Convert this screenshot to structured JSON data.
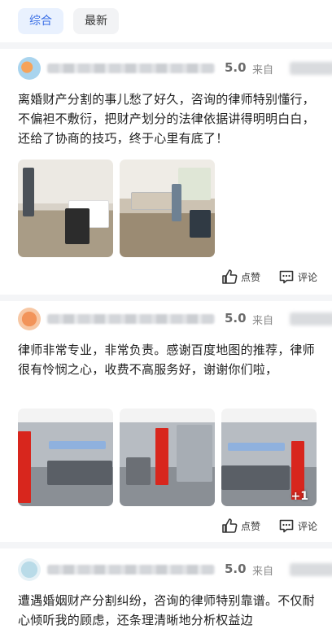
{
  "tabs": [
    {
      "label": "综合",
      "active": true
    },
    {
      "label": "最新",
      "active": false
    }
  ],
  "colors": {
    "accent": "#3a6fe6",
    "tab_active_bg": "#e9f1fe",
    "divider": "#f4f5f7"
  },
  "reviews": [
    {
      "score": "5.0",
      "source_prefix": "来自",
      "text": "离婚财产分割的事儿愁了好久，咨询的律师特别懂行，不偏袒不敷衍，把财产划分的法律依据讲得明明白白，还给了协商的技巧，终于心里有底了！",
      "photos": [
        "office-photo-1",
        "office-photo-2"
      ],
      "like_label": "点赞",
      "comment_label": "评论"
    },
    {
      "score": "5.0",
      "source_prefix": "来自",
      "text": "律师非常专业，非常负责。感谢百度地图的推荐，律师很有怜悯之心，收费不高服务好，谢谢你们啦，",
      "photos": [
        "lobby-photo-1",
        "lobby-photo-2",
        "lobby-photo-3"
      ],
      "more_count": "+1",
      "like_label": "点赞",
      "comment_label": "评论"
    },
    {
      "score": "5.0",
      "source_prefix": "来自",
      "text": "遭遇婚姻财产分割纠纷，咨询的律师特别靠谱。不仅耐心倾听我的顾虑，还条理清晰地分析权益边"
    }
  ]
}
